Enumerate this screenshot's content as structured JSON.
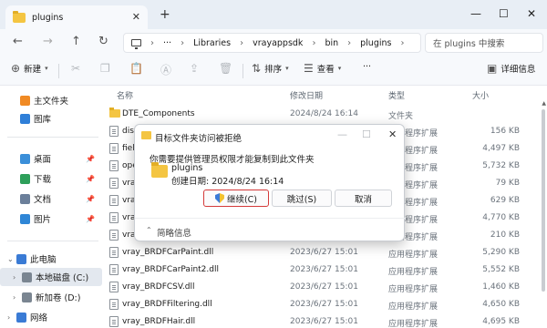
{
  "window": {
    "tab_title": "plugins",
    "tab_close": "✕",
    "new_tab": "+",
    "minimize": "—",
    "maximize": "☐",
    "close": "✕"
  },
  "address": {
    "more": "···",
    "parts": [
      "Libraries",
      "vrayappsdk",
      "bin",
      "plugins"
    ],
    "search_placeholder": "在 plugins 中搜索"
  },
  "toolbar": {
    "new_label": "新建",
    "sort_label": "排序",
    "view_label": "查看",
    "more": "···",
    "details_label": "详细信息"
  },
  "sidebar": {
    "items": [
      {
        "label": "主文件夹",
        "icon": "home-icon",
        "color": "#f08a24"
      },
      {
        "label": "图库",
        "icon": "gallery-icon",
        "color": "#2f7fd8"
      },
      {
        "label": "桌面",
        "icon": "desktop-icon",
        "color": "#3b8fd9"
      },
      {
        "label": "下载",
        "icon": "download-icon",
        "color": "#2e9f5a"
      },
      {
        "label": "文档",
        "icon": "document-icon",
        "color": "#6b7f9a"
      },
      {
        "label": "图片",
        "icon": "picture-icon",
        "color": "#2f86d6"
      },
      {
        "label": "此电脑",
        "icon": "computer-icon",
        "color": "#3a7bd5"
      },
      {
        "label": "本地磁盘 (C:)",
        "icon": "drive-icon",
        "color": "#7a8591"
      },
      {
        "label": "新加卷 (D:)",
        "icon": "drive-icon",
        "color": "#7a8591"
      },
      {
        "label": "网络",
        "icon": "network-icon",
        "color": "#3a7bd5"
      }
    ]
  },
  "columns": {
    "name": "名称",
    "date": "修改日期",
    "type": "类型",
    "size": "大小"
  },
  "files": [
    {
      "name": "DTE_Components",
      "date": "2024/8/24 16:14",
      "type": "文件夹",
      "size": "",
      "kind": "folder"
    },
    {
      "name": "dist",
      "date": "",
      "type": "应用程序扩展",
      "size": "156 KB",
      "kind": "dll"
    },
    {
      "name": "fiel",
      "date": "",
      "type": "应用程序扩展",
      "size": "4,497 KB",
      "kind": "dll"
    },
    {
      "name": "ope",
      "date": "",
      "type": "应用程序扩展",
      "size": "5,732 KB",
      "kind": "dll"
    },
    {
      "name": "vray",
      "date": "",
      "type": "应用程序扩展",
      "size": "79 KB",
      "kind": "dll"
    },
    {
      "name": "vray",
      "date": "",
      "type": "应用程序扩展",
      "size": "629 KB",
      "kind": "dll"
    },
    {
      "name": "vray",
      "date": "",
      "type": "应用程序扩展",
      "size": "4,770 KB",
      "kind": "dll"
    },
    {
      "name": "vray",
      "date": "",
      "type": "应用程序扩展",
      "size": "210 KB",
      "kind": "dll"
    },
    {
      "name": "vray_BRDFCarPaint.dll",
      "date": "2023/6/27 15:01",
      "type": "应用程序扩展",
      "size": "5,290 KB",
      "kind": "dll"
    },
    {
      "name": "vray_BRDFCarPaint2.dll",
      "date": "2023/6/27 15:01",
      "type": "应用程序扩展",
      "size": "5,552 KB",
      "kind": "dll"
    },
    {
      "name": "vray_BRDFCSV.dll",
      "date": "2023/6/27 15:01",
      "type": "应用程序扩展",
      "size": "1,460 KB",
      "kind": "dll"
    },
    {
      "name": "vray_BRDFFiltering.dll",
      "date": "2023/6/27 15:01",
      "type": "应用程序扩展",
      "size": "4,650 KB",
      "kind": "dll"
    },
    {
      "name": "vray_BRDFHair.dll",
      "date": "2023/6/27 15:01",
      "type": "应用程序扩展",
      "size": "4,695 KB",
      "kind": "dll"
    }
  ],
  "dialog": {
    "title": "目标文件夹访问被拒绝",
    "message": "你需要提供管理员权限才能复制到此文件夹",
    "folder_name": "plugins",
    "folder_date": "创建日期: 2024/8/24 16:14",
    "continue_label": "继续(C)",
    "skip_label": "跳过(S)",
    "cancel_label": "取消",
    "brief_label": "简略信息",
    "minimize": "—",
    "maximize": "☐",
    "close": "✕"
  }
}
